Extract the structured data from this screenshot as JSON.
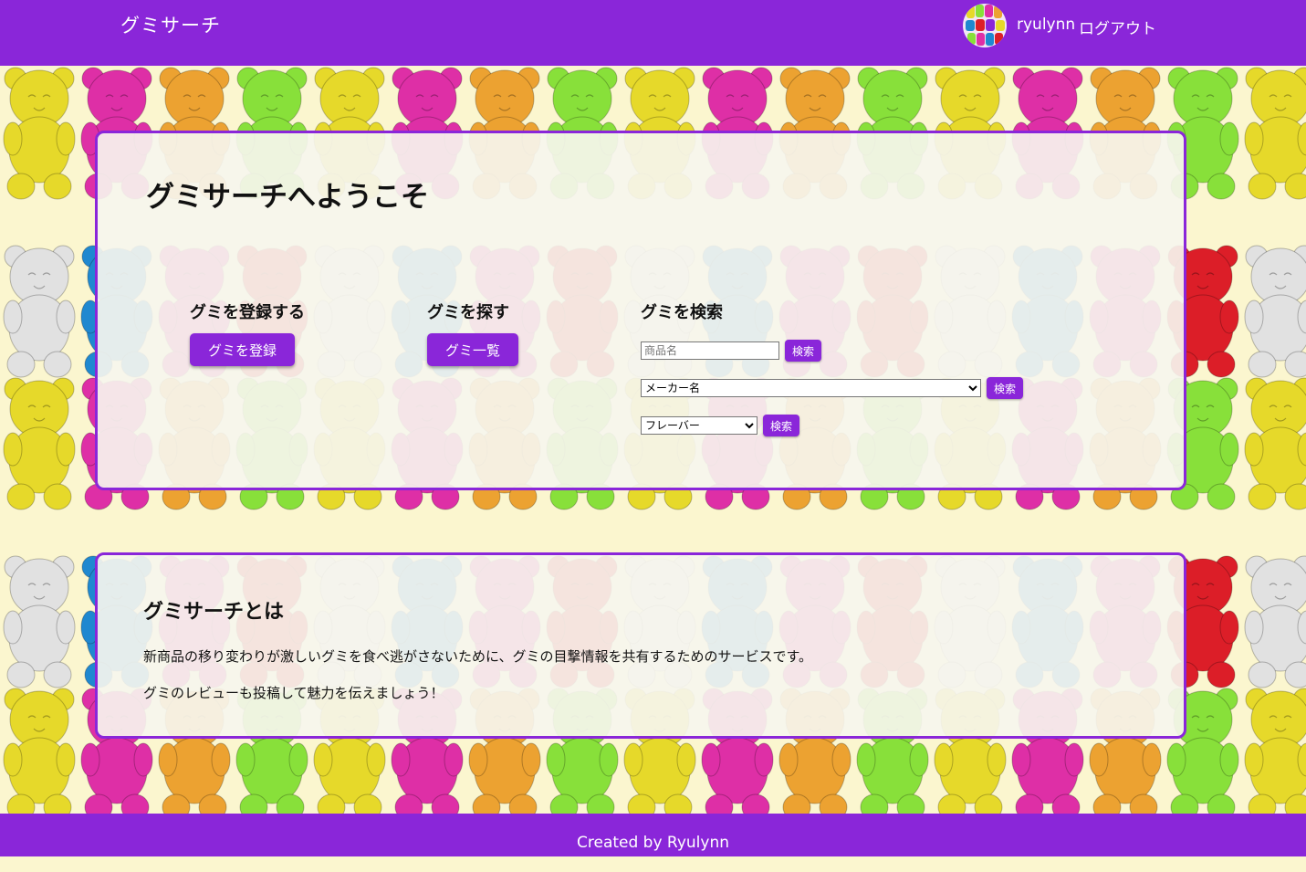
{
  "header": {
    "brand": "グミサーチ",
    "username": "ryulynn",
    "logout_label": "ログアウト"
  },
  "welcome": {
    "title": "グミサーチへようこそ",
    "register": {
      "heading": "グミを登録する",
      "button": "グミを登録"
    },
    "browse": {
      "heading": "グミを探す",
      "button": "グミ一覧"
    },
    "search": {
      "heading": "グミを検索",
      "name_placeholder": "商品名",
      "name_button": "検索",
      "maker_selected": "メーカー名",
      "maker_button": "検索",
      "flavor_selected": "フレーバー",
      "flavor_button": "検索"
    }
  },
  "about": {
    "title": "グミサーチとは",
    "line1": "新商品の移り変わりが激しいグミを食べ逃がさないために、グミの目撃情報を共有するためのサービスです。",
    "line2": "グミのレビューも投稿して魅力を伝えましょう！"
  },
  "footer": {
    "credit": "Created by Ryulynn"
  },
  "colors": {
    "accent": "#8a26d9",
    "background": "#fbf6cf",
    "bear_colors": [
      "#e6d92a",
      "#de2fa6",
      "#eca231",
      "#88e03a",
      "#e1e1e1",
      "#1f88d0",
      "#dc1e28"
    ]
  }
}
